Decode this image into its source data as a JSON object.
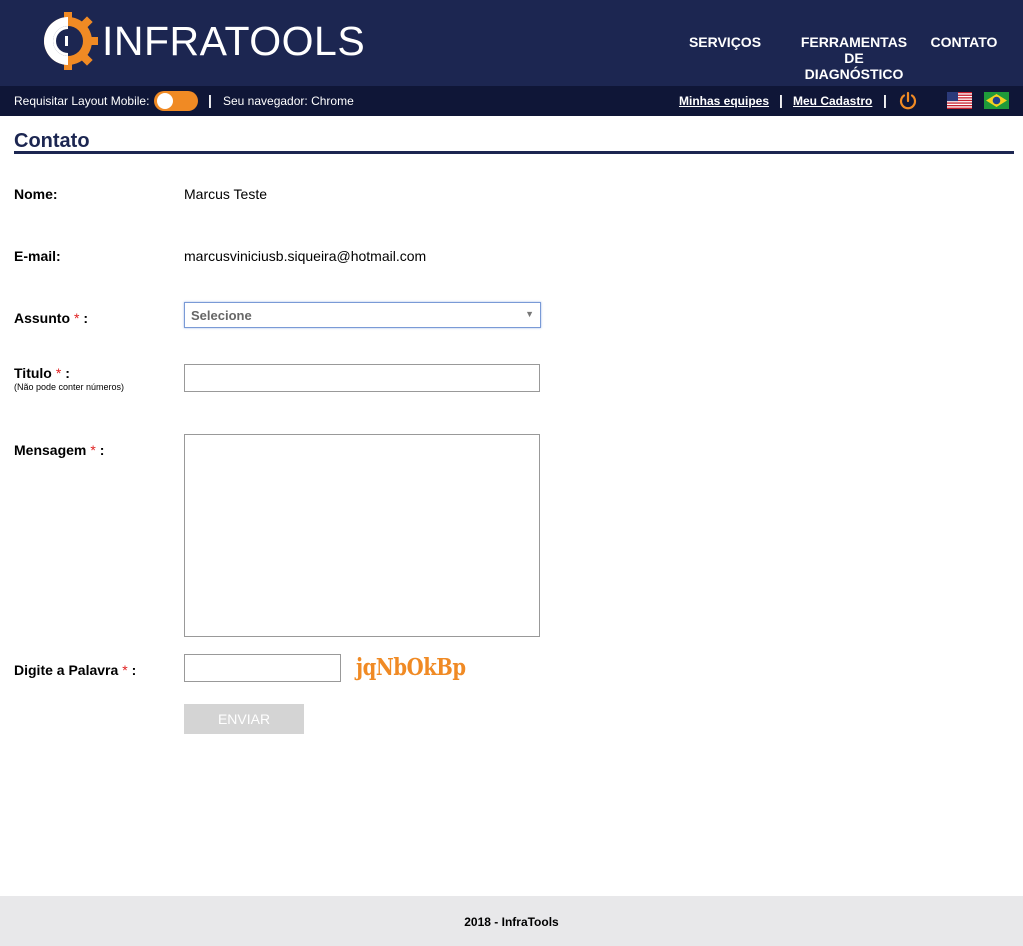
{
  "header": {
    "logo_text": "INFRATOOLS",
    "nav": [
      {
        "label_lines": [
          "SERVIÇOS"
        ]
      },
      {
        "label_lines": [
          "FERRAMENTAS",
          "DE",
          "DIAGNÓSTICO"
        ]
      },
      {
        "label_lines": [
          "CONTATO"
        ]
      }
    ]
  },
  "subbar": {
    "mobile_label": "Requisitar Layout Mobile:",
    "separator": "|",
    "browser_info": "Seu navegador: Chrome",
    "link_equipes": "Minhas equipes",
    "link_cadastro": "Meu Cadastro",
    "power_icon": "power-icon",
    "flags": [
      "us-flag-icon",
      "br-flag-icon"
    ]
  },
  "page": {
    "title": "Contato"
  },
  "form": {
    "required_mark": "*",
    "nome_label": "Nome:",
    "nome_value": "Marcus Teste",
    "email_label": "E-mail:",
    "email_value": "marcusviniciusb.siqueira@hotmail.com",
    "assunto_label": "Assunto",
    "assunto_selected": "Selecione",
    "titulo_label": "Titulo",
    "titulo_hint": "(Não pode conter números)",
    "titulo_value": "",
    "mensagem_label": "Mensagem",
    "mensagem_value": "",
    "palavra_label": "Digite a Palavra",
    "palavra_value": "",
    "captcha_text": "jqNbOkBp",
    "colon": ":",
    "submit_label": "ENVIAR"
  },
  "footer": {
    "text": "2018 - InfraTools"
  },
  "colors": {
    "header_bg": "#1c2651",
    "subbar_bg": "#0f1637",
    "accent_orange": "#f08a24",
    "required_red": "#e02020"
  }
}
